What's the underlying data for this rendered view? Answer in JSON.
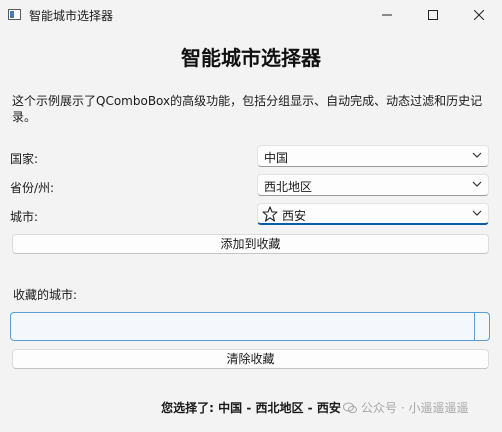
{
  "window": {
    "title": "智能城市选择器",
    "controls": [
      "minimize-icon",
      "maximize-icon",
      "close-icon"
    ]
  },
  "heading": "智能城市选择器",
  "description": "这个示例展示了QComboBox的高级功能，包括分组显示、自动完成、动态过滤和历史记录。",
  "form": {
    "country": {
      "label": "国家:",
      "value": "中国"
    },
    "province": {
      "label": "省份/州:",
      "value": "西北地区"
    },
    "city": {
      "label": "城市:",
      "value": "西安",
      "icon": "star-outline-icon"
    }
  },
  "buttons": {
    "add_favorite": "添加到收藏",
    "clear_favorites": "清除收藏"
  },
  "favorites": {
    "label": "收藏的城市:",
    "items": []
  },
  "selection_text": "您选择了: 中国 - 西北地区 - 西安",
  "watermark": "公众号 · 小遥遥遥遥",
  "colors": {
    "accent": "#0b5cad",
    "list_border": "#5a9ed6",
    "list_bg": "#f4f8fc"
  }
}
